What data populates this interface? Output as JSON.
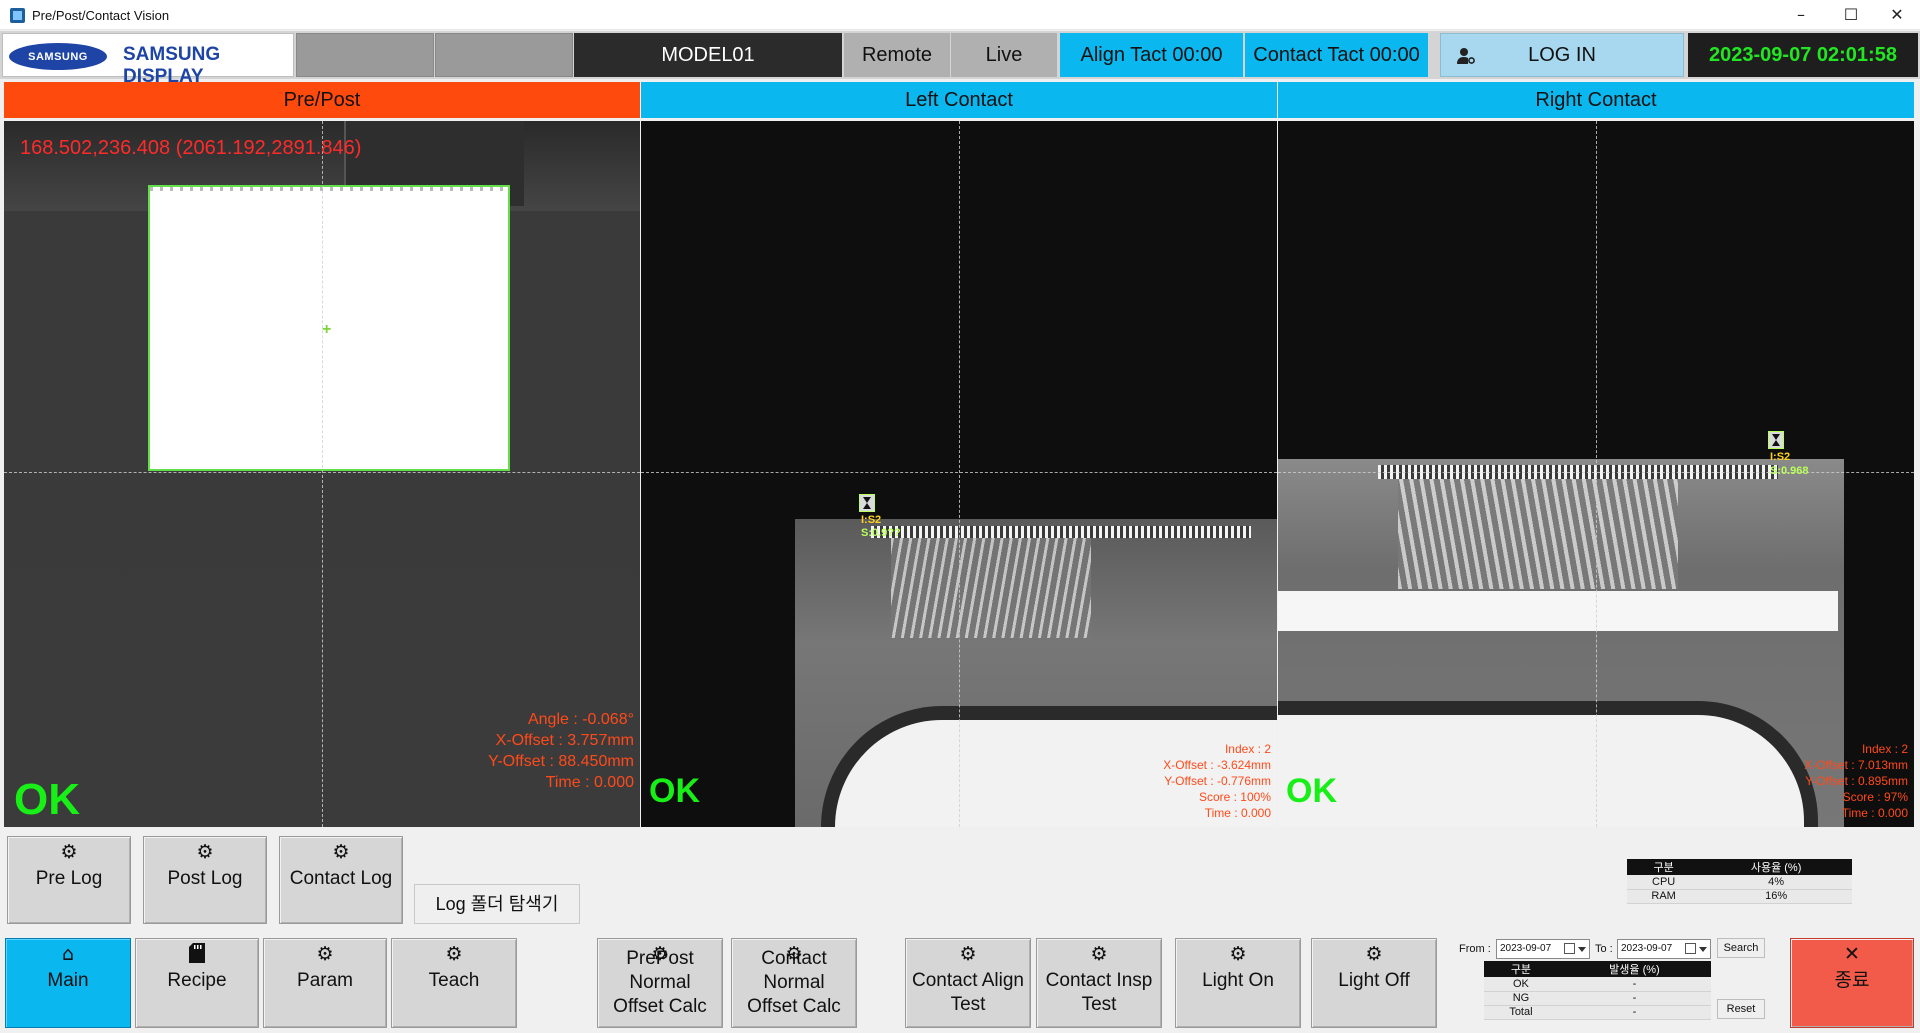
{
  "window": {
    "title": "Pre/Post/Contact Vision",
    "minimize": "–",
    "maximize": "☐",
    "close": "✕"
  },
  "header": {
    "samsung": "SAMSUNG",
    "brand": "SAMSUNG DISPLAY",
    "model": "MODEL01",
    "remote": "Remote",
    "live": "Live",
    "align_tact": "Align Tact 00:00",
    "contact_tact": "Contact Tact 00:00",
    "login": "LOG IN",
    "datetime": "2023-09-07 02:01:58"
  },
  "panels": {
    "pre": {
      "title": "Pre/Post",
      "coord": "168.502,236.408 (2061.192,2891.846)",
      "angle": "Angle : -0.068°",
      "x_offset": "X-Offset : 3.757mm",
      "y_offset": "Y-Offset : 88.450mm",
      "time": "Time : 0.000",
      "result": "OK"
    },
    "left": {
      "title": "Left Contact",
      "mark_i": "I:S2",
      "mark_s": "S:0.9??",
      "index": "Index : 2",
      "x_offset": "X-Offset : -3.624mm",
      "y_offset": "Y-Offset : -0.776mm",
      "score": "Score : 100%",
      "time": "Time : 0.000",
      "result": "OK"
    },
    "right": {
      "title": "Right Contact",
      "mark_i": "I:S2",
      "mark_s": "S:0.968",
      "index": "Index : 2",
      "x_offset": "X-Offset : 7.013mm",
      "y_offset": "Y-Offset : 0.895mm",
      "score": "Score : 97%",
      "time": "Time : 0.000",
      "result": "OK"
    }
  },
  "log_buttons": {
    "pre_log": "Pre Log",
    "post_log": "Post Log",
    "contact_log": "Contact Log",
    "log_folder": "Log 폴더 탐색기"
  },
  "usage": {
    "headers": [
      "구분",
      "사용율 (%)"
    ],
    "rows": [
      [
        "CPU",
        "4%"
      ],
      [
        "RAM",
        "16%"
      ]
    ]
  },
  "nav": {
    "main": "Main",
    "recipe": "Recipe",
    "param": "Param",
    "teach": "Teach",
    "prepost_calc": "PrePost\nNormal\nOffset Calc",
    "contact_calc": "Contact\nNormal\nOffset Calc",
    "contact_align": "Contact Align\nTest",
    "contact_insp": "Contact Insp\nTest",
    "light_on": "Light On",
    "light_off": "Light Off",
    "exit": "종료"
  },
  "date_filter": {
    "from_label": "From :",
    "from": "2023-09-07",
    "to_label": "To :",
    "to": "2023-09-07",
    "search": "Search",
    "reset": "Reset"
  },
  "rate": {
    "headers": [
      "구분",
      "발생율 (%)"
    ],
    "rows": [
      [
        "OK",
        "-"
      ],
      [
        "NG",
        "-"
      ],
      [
        "Total",
        "-"
      ]
    ]
  },
  "icons": {
    "gear": "⚙",
    "home": "⌂",
    "close": "✕",
    "user_gear": "user-gear"
  },
  "colors": {
    "accent_blue": "#0ab7ee",
    "pre_orange": "#ff4a0e",
    "ok_green": "#17ef17",
    "info_red": "#ff4a1a",
    "clock_green": "#22e622"
  }
}
